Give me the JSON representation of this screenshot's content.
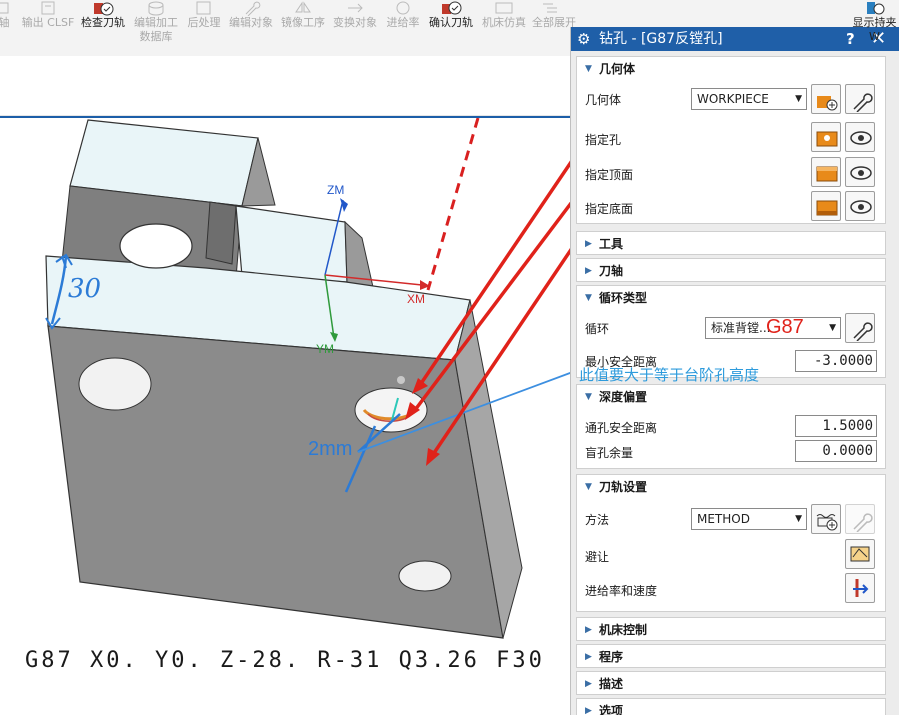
{
  "ribbon": {
    "items": [
      {
        "label": "轴",
        "enabled": false
      },
      {
        "label": "输出 CLSF",
        "enabled": false
      },
      {
        "label": "检查刀轨",
        "enabled": true
      },
      {
        "label": "编辑加工",
        "label2": "数据库",
        "enabled": false
      },
      {
        "label": "后处理",
        "enabled": false
      },
      {
        "label": "编辑对象",
        "enabled": false
      },
      {
        "label": "镜像工序",
        "enabled": false
      },
      {
        "label": "变换对象",
        "enabled": false
      },
      {
        "label": "进给率",
        "enabled": false
      },
      {
        "label": "确认刀轨",
        "enabled": true
      },
      {
        "label": "机床仿真",
        "enabled": false
      },
      {
        "label": "全部展开",
        "enabled": false
      }
    ],
    "right_label": "显示持夹",
    "right_label2": "W"
  },
  "viewport": {
    "axis_zm": "ZM",
    "axis_xm": "XM",
    "axis_ym": "YM",
    "hand_30": "30",
    "hand_2mm": "2mm",
    "gcode": "G87 X0. Y0. Z-28. R-31 Q3.26 F30",
    "note": "此值要大于等于台阶孔高度",
    "g87_label": "G87"
  },
  "dialog": {
    "title": "钻孔 - [G87反镗孔]",
    "help": "?",
    "close": "✕",
    "sections": {
      "geometry": {
        "title": "几何体",
        "geometry_label": "几何体",
        "geometry_value": "WORKPIECE",
        "hole_label": "指定孔",
        "top_label": "指定顶面",
        "bottom_label": "指定底面"
      },
      "tool": {
        "title": "工具"
      },
      "axis": {
        "title": "刀轴"
      },
      "cycle": {
        "title": "循环类型",
        "cycle_label": "循环",
        "cycle_value": "标准背镗...",
        "min_clear_label": "最小安全距离",
        "min_clear_value": "-3.0000"
      },
      "depth": {
        "title": "深度偏置",
        "through_label": "通孔安全距离",
        "through_value": "1.5000",
        "blind_label": "盲孔余量",
        "blind_value": "0.0000"
      },
      "path": {
        "title": "刀轨设置",
        "method_label": "方法",
        "method_value": "METHOD",
        "avoid_label": "避让",
        "feeds_label": "进给率和速度"
      },
      "machine": {
        "title": "机床控制"
      },
      "program": {
        "title": "程序"
      },
      "desc": {
        "title": "描述"
      },
      "options": {
        "title": "选项"
      }
    }
  },
  "colors": {
    "title_bar": "#1f5fa8",
    "accent_blue": "#2c7bd6",
    "annotation_red": "#e0221a",
    "part_face": "#e8f4f8",
    "part_side": "#8c8c8c"
  }
}
